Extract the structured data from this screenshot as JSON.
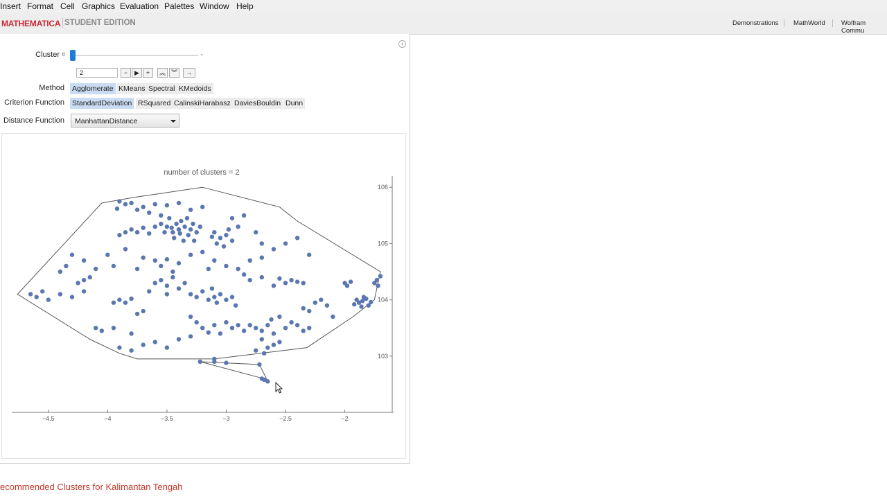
{
  "menu": [
    "Insert",
    "Format",
    "Cell",
    "Graphics",
    "Evaluation",
    "Palettes",
    "Window",
    "Help"
  ],
  "brand": {
    "name": "MATHEMATICA",
    "edition": "STUDENT EDITION"
  },
  "toplinks": [
    "Demonstrations",
    "MathWorld",
    "Wolfram Commu"
  ],
  "controls": {
    "cluster_label": "Cluster",
    "cluster_value": "2",
    "slider_fraction": 0.0,
    "method_label": "Method",
    "methods": [
      "Agglomerate",
      "KMeans",
      "Spectral",
      "KMedoids"
    ],
    "method_selected": "Agglomerate",
    "criterion_label": "Criterion Function",
    "criteria": [
      "StandardDeviation",
      "RSquared",
      "CalinskiHarabasz",
      "DaviesBouldin",
      "Dunn"
    ],
    "criterion_selected": "StandardDeviation",
    "distance_label": "Distance Function",
    "distance_value": "ManhattanDistance"
  },
  "colors": {
    "point": "#5b77b0",
    "hull": "#555555",
    "tab_selected": "#c9dcf1",
    "brand": "#cc2a36",
    "section": "#c0392b"
  },
  "chart_data": {
    "type": "scatter",
    "title": "number of clusters = 2",
    "xlabel": "",
    "ylabel": "",
    "xlim": [
      -4.75,
      -1.6
    ],
    "ylim": [
      102.0,
      106.2
    ],
    "xticks": [
      -4.5,
      -4.0,
      -3.5,
      -3.0,
      -2.5,
      -2.0
    ],
    "yticks": [
      103,
      104,
      105,
      106
    ],
    "hulls": [
      [
        [
          -4.76,
          104.1
        ],
        [
          -4.05,
          105.72
        ],
        [
          -3.78,
          105.82
        ],
        [
          -3.2,
          106.0
        ],
        [
          -2.55,
          105.65
        ],
        [
          -2.4,
          105.4
        ],
        [
          -1.7,
          104.5
        ],
        [
          -1.75,
          104.0
        ],
        [
          -1.93,
          103.7
        ],
        [
          -2.32,
          103.15
        ],
        [
          -3.1,
          102.95
        ],
        [
          -3.75,
          102.95
        ],
        [
          -3.9,
          103.05
        ],
        [
          -4.15,
          103.3
        ]
      ],
      [
        [
          -3.22,
          102.9
        ],
        [
          -2.72,
          102.85
        ],
        [
          -2.65,
          102.55
        ],
        [
          -2.72,
          102.62
        ]
      ]
    ],
    "series": [
      {
        "points": [
          [
            -3.5,
            105.3
          ],
          [
            -3.45,
            105.2
          ],
          [
            -3.42,
            105.35
          ],
          [
            -3.4,
            105.25
          ],
          [
            -3.38,
            105.4
          ],
          [
            -3.35,
            105.3
          ],
          [
            -3.32,
            105.15
          ],
          [
            -3.3,
            105.25
          ],
          [
            -3.28,
            105.35
          ],
          [
            -3.25,
            105.2
          ],
          [
            -3.48,
            105.45
          ],
          [
            -3.44,
            105.1
          ],
          [
            -3.36,
            105.05
          ],
          [
            -3.52,
            105.2
          ],
          [
            -3.55,
            105.35
          ],
          [
            -3.33,
            105.45
          ],
          [
            -3.27,
            105.05
          ],
          [
            -3.22,
            105.3
          ],
          [
            -3.46,
            105.28
          ],
          [
            -3.39,
            105.18
          ],
          [
            -3.1,
            105.2
          ],
          [
            -3.05,
            105.1
          ],
          [
            -3.0,
            105.15
          ],
          [
            -2.95,
            105.05
          ],
          [
            -3.08,
            105.0
          ],
          [
            -2.98,
            105.25
          ],
          [
            -3.02,
            104.95
          ],
          [
            -3.12,
            105.12
          ],
          [
            -3.9,
            105.75
          ],
          [
            -3.85,
            105.7
          ],
          [
            -3.8,
            105.72
          ],
          [
            -3.75,
            105.6
          ],
          [
            -3.7,
            105.65
          ],
          [
            -3.6,
            105.7
          ],
          [
            -3.5,
            105.68
          ],
          [
            -3.4,
            105.72
          ],
          [
            -3.3,
            105.6
          ],
          [
            -3.2,
            105.65
          ],
          [
            -3.65,
            105.55
          ],
          [
            -3.55,
            105.5
          ],
          [
            -3.92,
            105.62
          ],
          [
            -3.85,
            105.2
          ],
          [
            -3.8,
            105.25
          ],
          [
            -3.75,
            105.2
          ],
          [
            -3.7,
            105.28
          ],
          [
            -3.65,
            105.18
          ],
          [
            -3.9,
            105.15
          ],
          [
            -3.6,
            105.3
          ],
          [
            -4.0,
            104.8
          ],
          [
            -3.85,
            104.9
          ],
          [
            -3.7,
            104.75
          ],
          [
            -3.6,
            104.7
          ],
          [
            -3.5,
            104.72
          ],
          [
            -3.4,
            104.65
          ],
          [
            -3.3,
            104.8
          ],
          [
            -3.2,
            104.85
          ],
          [
            -3.1,
            104.7
          ],
          [
            -3.0,
            104.6
          ],
          [
            -2.9,
            104.55
          ],
          [
            -2.8,
            104.7
          ],
          [
            -2.7,
            104.75
          ],
          [
            -3.95,
            104.6
          ],
          [
            -3.75,
            104.55
          ],
          [
            -3.55,
            104.6
          ],
          [
            -3.45,
            104.5
          ],
          [
            -3.15,
            104.55
          ],
          [
            -2.85,
            104.45
          ],
          [
            -4.4,
            104.1
          ],
          [
            -4.3,
            104.05
          ],
          [
            -4.2,
            104.15
          ],
          [
            -4.5,
            104.0
          ],
          [
            -4.6,
            104.05
          ],
          [
            -4.65,
            104.1
          ],
          [
            -4.55,
            104.15
          ],
          [
            -4.25,
            104.3
          ],
          [
            -4.2,
            104.35
          ],
          [
            -4.15,
            104.4
          ],
          [
            -3.95,
            103.95
          ],
          [
            -3.9,
            104.0
          ],
          [
            -3.85,
            103.95
          ],
          [
            -3.8,
            104.02
          ],
          [
            -3.7,
            103.8
          ],
          [
            -3.75,
            103.75
          ],
          [
            -3.3,
            104.1
          ],
          [
            -3.25,
            104.05
          ],
          [
            -3.2,
            104.15
          ],
          [
            -3.15,
            104.0
          ],
          [
            -3.1,
            104.05
          ],
          [
            -3.05,
            104.1
          ],
          [
            -3.0,
            104.0
          ],
          [
            -2.95,
            104.05
          ],
          [
            -3.12,
            104.2
          ],
          [
            -3.08,
            103.95
          ],
          [
            -2.92,
            103.9
          ],
          [
            -3.3,
            103.7
          ],
          [
            -3.25,
            103.6
          ],
          [
            -3.2,
            103.5
          ],
          [
            -3.1,
            103.55
          ],
          [
            -3.0,
            103.6
          ],
          [
            -2.95,
            103.5
          ],
          [
            -2.9,
            103.55
          ],
          [
            -2.85,
            103.45
          ],
          [
            -3.15,
            103.42
          ],
          [
            -3.05,
            103.4
          ],
          [
            -2.8,
            103.55
          ],
          [
            -2.75,
            103.5
          ],
          [
            -2.7,
            103.45
          ],
          [
            -2.65,
            103.55
          ],
          [
            -2.6,
            103.4
          ],
          [
            -2.7,
            103.3
          ],
          [
            -2.65,
            103.15
          ],
          [
            -2.6,
            103.2
          ],
          [
            -2.55,
            103.25
          ],
          [
            -2.5,
            103.5
          ],
          [
            -2.45,
            103.6
          ],
          [
            -2.4,
            103.55
          ],
          [
            -2.35,
            103.45
          ],
          [
            -2.3,
            103.5
          ],
          [
            -2.55,
            103.7
          ],
          [
            -2.62,
            103.65
          ],
          [
            -2.75,
            103.1
          ],
          [
            -2.68,
            103.05
          ],
          [
            -2.5,
            104.3
          ],
          [
            -2.45,
            104.35
          ],
          [
            -2.4,
            104.32
          ],
          [
            -2.35,
            104.3
          ],
          [
            -2.55,
            104.38
          ],
          [
            -2.6,
            104.25
          ],
          [
            -2.7,
            104.4
          ],
          [
            -2.8,
            104.35
          ],
          [
            -2.0,
            104.3
          ],
          [
            -1.98,
            104.25
          ],
          [
            -1.95,
            104.32
          ],
          [
            -1.9,
            104.0
          ],
          [
            -1.88,
            103.95
          ],
          [
            -1.85,
            103.98
          ],
          [
            -1.82,
            104.02
          ],
          [
            -1.8,
            103.9
          ],
          [
            -1.78,
            103.96
          ],
          [
            -1.86,
            103.88
          ],
          [
            -1.92,
            103.92
          ],
          [
            -1.84,
            104.05
          ],
          [
            -1.75,
            104.3
          ],
          [
            -1.73,
            104.35
          ],
          [
            -1.72,
            104.25
          ],
          [
            -1.7,
            104.42
          ],
          [
            -2.3,
            104.8
          ],
          [
            -2.4,
            105.1
          ],
          [
            -2.5,
            105.0
          ],
          [
            -2.6,
            104.9
          ],
          [
            -2.7,
            105.0
          ],
          [
            -2.75,
            105.2
          ],
          [
            -2.9,
            105.3
          ],
          [
            -2.95,
            105.45
          ],
          [
            -2.85,
            105.5
          ],
          [
            -4.1,
            103.5
          ],
          [
            -4.05,
            103.45
          ],
          [
            -3.95,
            103.5
          ],
          [
            -3.8,
            103.4
          ],
          [
            -3.7,
            103.2
          ],
          [
            -3.6,
            103.25
          ],
          [
            -3.5,
            103.15
          ],
          [
            -3.4,
            103.3
          ],
          [
            -3.3,
            103.35
          ],
          [
            -3.8,
            103.1
          ],
          [
            -3.9,
            103.15
          ],
          [
            -4.4,
            104.5
          ],
          [
            -4.35,
            104.6
          ],
          [
            -4.2,
            104.7
          ],
          [
            -4.3,
            104.8
          ],
          [
            -4.1,
            104.55
          ],
          [
            -3.6,
            104.3
          ],
          [
            -3.55,
            104.35
          ],
          [
            -3.5,
            104.25
          ],
          [
            -3.45,
            104.4
          ],
          [
            -3.4,
            104.2
          ],
          [
            -3.35,
            104.3
          ],
          [
            -3.65,
            104.15
          ],
          [
            -3.5,
            104.1
          ],
          [
            -2.2,
            104.0
          ],
          [
            -2.25,
            103.95
          ],
          [
            -2.3,
            103.8
          ],
          [
            -2.35,
            103.85
          ],
          [
            -2.15,
            103.9
          ],
          [
            -2.1,
            103.7
          ],
          [
            -3.22,
            102.9
          ],
          [
            -3.1,
            102.9
          ],
          [
            -3.0,
            102.88
          ],
          [
            -2.72,
            102.85
          ],
          [
            -2.7,
            102.6
          ],
          [
            -2.68,
            102.58
          ],
          [
            -2.65,
            102.55
          ],
          [
            -3.1,
            102.95
          ]
        ]
      }
    ]
  },
  "section_title": "ecommended Clusters for Kalimantan Tengah"
}
